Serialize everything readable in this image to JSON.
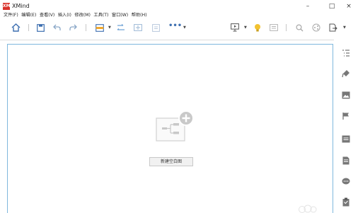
{
  "window": {
    "title": "XMind",
    "logo_text": "XM",
    "controls": {
      "minimize": "–",
      "maximize": "□",
      "close": "×"
    }
  },
  "menu": {
    "items": [
      "文件(F)",
      "编辑(E)",
      "查看(V)",
      "插入(I)",
      "修改(M)",
      "工具(T)",
      "窗口(W)",
      "帮助(H)"
    ]
  },
  "toolbar": {
    "more_label": "•••",
    "icons": [
      "home-icon",
      "save-icon",
      "undo-icon",
      "redo-icon",
      "theme-icon",
      "topic-icon",
      "subtopic-icon",
      "floating-topic-icon",
      "more-icon",
      "presentation-icon",
      "lightbulb-icon",
      "outline-icon",
      "search-icon",
      "share-icon",
      "export-icon"
    ]
  },
  "canvas": {
    "new_blank_label": "新建空白图"
  },
  "right_panel": {
    "icons": [
      "outline-panel-icon",
      "format-brush-icon",
      "image-icon",
      "marker-flag-icon",
      "note-icon",
      "document-icon",
      "comment-icon",
      "clipboard-icon"
    ]
  },
  "colors": {
    "accent_blue": "#3d6fb0",
    "canvas_border": "#7fb8dd",
    "logo_red": "#d9322b",
    "lightbulb_yellow": "#f2c230",
    "theme_orange": "#f0a830"
  }
}
